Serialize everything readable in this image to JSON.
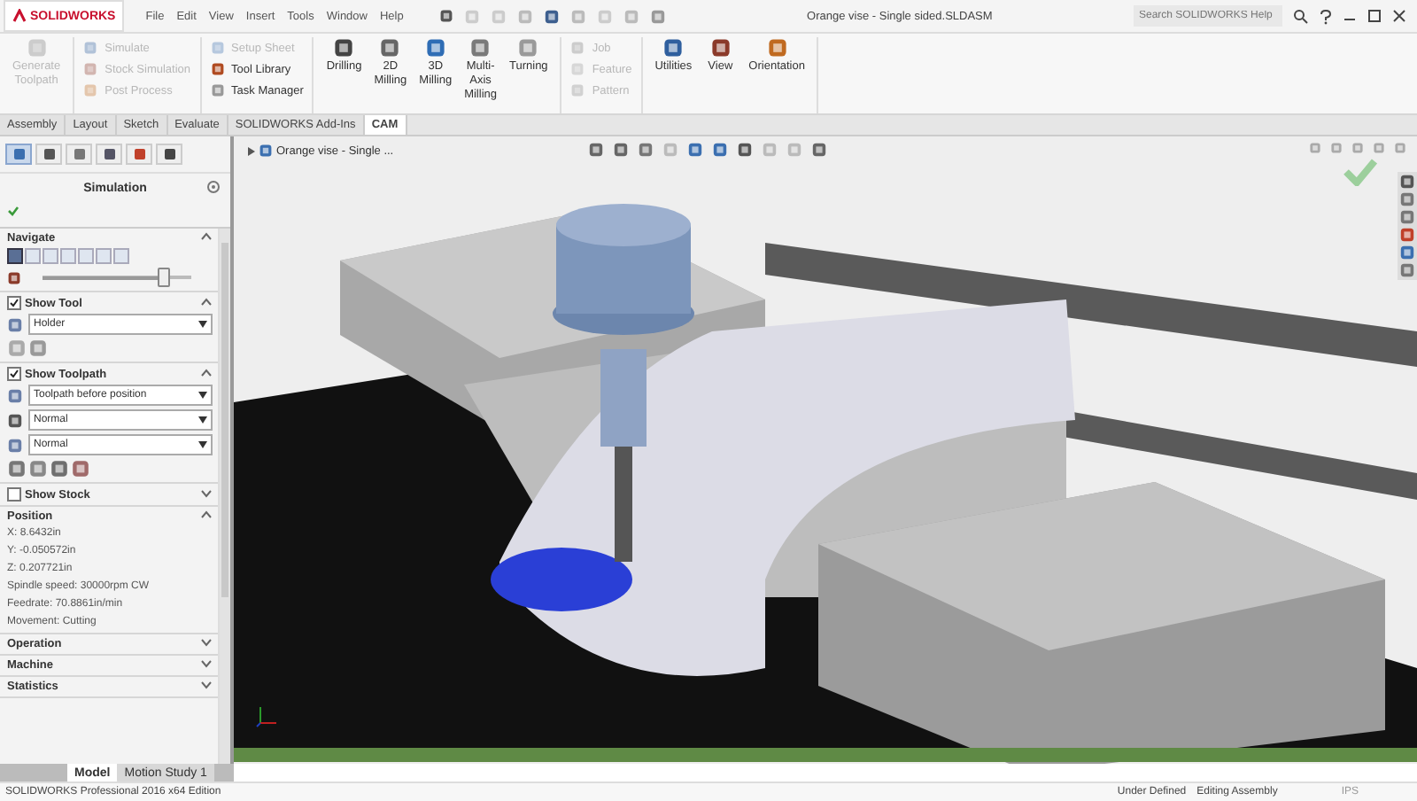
{
  "title_bar": {
    "logo": "SOLIDWORKS",
    "menu": [
      "File",
      "Edit",
      "View",
      "Insert",
      "Tools",
      "Window",
      "Help"
    ],
    "title": "Orange vise - Single sided.SLDASM",
    "search": {
      "placeholder": "Search SOLIDWORKS Help"
    }
  },
  "ribbon": {
    "groups": [
      {
        "kind": "large",
        "items": [
          {
            "label": "Generate Toolpath",
            "disabled": true
          }
        ]
      },
      {
        "kind": "small",
        "items": [
          {
            "label": "Simulate",
            "disabled": true
          },
          {
            "label": "Stock Simulation",
            "disabled": true
          },
          {
            "label": "Post Process",
            "disabled": true
          }
        ]
      },
      {
        "kind": "small",
        "items": [
          {
            "label": "Setup Sheet",
            "disabled": true
          },
          {
            "label": "Tool Library",
            "disabled": false
          },
          {
            "label": "Task Manager",
            "disabled": false
          }
        ]
      },
      {
        "kind": "large",
        "items": [
          {
            "label": "Drilling",
            "disabled": false
          },
          {
            "label": "2D Milling",
            "disabled": false
          },
          {
            "label": "3D Milling",
            "disabled": false
          },
          {
            "label": "Multi-Axis Milling",
            "disabled": false
          },
          {
            "label": "Turning",
            "disabled": false
          }
        ]
      },
      {
        "kind": "small",
        "items": [
          {
            "label": "Job",
            "disabled": true
          },
          {
            "label": "Feature",
            "disabled": true
          },
          {
            "label": "Pattern",
            "disabled": true
          }
        ]
      },
      {
        "kind": "large",
        "items": [
          {
            "label": "Utilities",
            "disabled": false
          },
          {
            "label": "View",
            "disabled": false
          },
          {
            "label": "Orientation",
            "disabled": false
          }
        ]
      }
    ]
  },
  "tabs": [
    {
      "label": "Assembly",
      "selected": false
    },
    {
      "label": "Layout",
      "selected": false
    },
    {
      "label": "Sketch",
      "selected": false
    },
    {
      "label": "Evaluate",
      "selected": false
    },
    {
      "label": "SOLIDWORKS Add-Ins",
      "selected": false
    },
    {
      "label": "CAM",
      "selected": true
    }
  ],
  "panel": {
    "tabs": [
      {
        "selected": true
      },
      {
        "selected": false
      },
      {
        "selected": false
      },
      {
        "selected": false
      },
      {
        "selected": false
      },
      {
        "selected": false
      }
    ],
    "title": "Simulation",
    "sections": [
      {
        "kind": "navigate",
        "title": "Navigate",
        "expanded": true,
        "buttons": [
          {
            "selected": true
          },
          {
            "selected": false
          },
          {
            "selected": false
          },
          {
            "selected": false
          },
          {
            "selected": false
          },
          {
            "selected": false
          },
          {
            "selected": false
          }
        ],
        "level": 0.83
      },
      {
        "kind": "tool",
        "title": "Show Tool",
        "checked": true,
        "expanded": true,
        "dropdowns": [
          "Holder"
        ]
      },
      {
        "kind": "toolpath",
        "title": "Show Toolpath",
        "checked": true,
        "expanded": true,
        "dropdowns": [
          "Toolpath before position",
          "Normal",
          "Normal"
        ]
      },
      {
        "kind": "stock",
        "title": "Show Stock",
        "checked": false,
        "expanded": false
      },
      {
        "kind": "info",
        "title": "Position",
        "expanded": true,
        "lines": [
          "X: 8.6432in",
          "Y: -0.050572in",
          "Z: 0.207721in",
          "Spindle speed: 30000rpm CW",
          "Feedrate: 70.8861in/min",
          "Movement: Cutting"
        ]
      },
      {
        "kind": "info",
        "title": "Operation",
        "expanded": false
      },
      {
        "kind": "info",
        "title": "Machine",
        "expanded": false
      },
      {
        "kind": "info",
        "title": "Statistics",
        "expanded": false
      }
    ]
  },
  "viewport": {
    "tree_item": "Orange vise - Single ..."
  },
  "bottom_tabs": [
    {
      "label": "Model",
      "selected": true
    },
    {
      "label": "Motion Study 1",
      "selected": false
    }
  ],
  "status_bar": {
    "edition": "SOLIDWORKS Professional 2016 x64 Edition",
    "state": "Under Defined",
    "mode": "Editing Assembly",
    "units": "IPS"
  }
}
